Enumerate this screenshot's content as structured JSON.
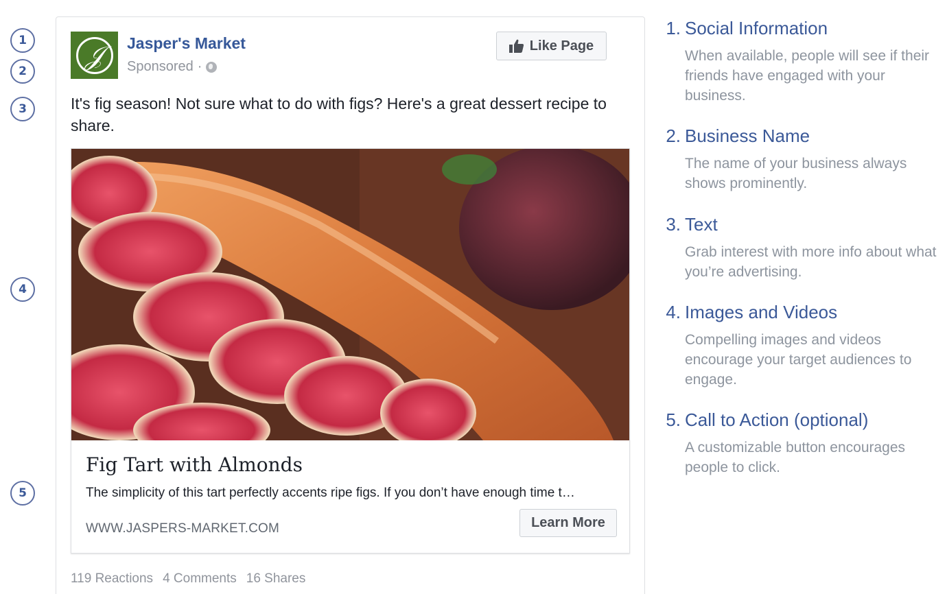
{
  "markers": [
    "1",
    "2",
    "3",
    "4",
    "5"
  ],
  "post": {
    "page_name": "Jasper's Market",
    "sponsored_label": "Sponsored",
    "meta_separator": "·",
    "like_page_label": "Like Page",
    "text": "It's fig season! Not sure what to do with figs? Here's a great dessert recipe to share.",
    "attachment": {
      "image_icon": "fig-tart-photo",
      "title": "Fig Tart with Almonds",
      "description": "The simplicity of this tart perfectly accents ripe figs. If you don’t have enough time t…",
      "domain": "WWW.JASPERS-MARKET.COM",
      "cta_label": "Learn More"
    },
    "engagement": {
      "reactions": "119 Reactions",
      "comments": "4 Comments",
      "shares": "16 Shares"
    }
  },
  "legend": [
    {
      "num": "1.",
      "title": "Social Information",
      "body": "When available, people will see if their friends have engaged with your business."
    },
    {
      "num": "2.",
      "title": "Business Name",
      "body": "The name of your business always shows prominently."
    },
    {
      "num": "3.",
      "title": "Text",
      "body": "Grab interest with more info about what you’re advertising."
    },
    {
      "num": "4.",
      "title": "Images and Videos",
      "body": "Compelling images and videos encourage your target audiences to engage."
    },
    {
      "num": "5.",
      "title": "Call to Action (optional)",
      "body": "A customizable button encourages people to click."
    }
  ],
  "colors": {
    "brand_blue": "#3b5998",
    "link_blue": "#365899",
    "muted_text": "#90949c",
    "avatar_green": "#4a7a28"
  },
  "icons": {
    "avatar": "jaspers-market-logo",
    "privacy": "globe-icon",
    "like": "thumbs-up-icon"
  }
}
